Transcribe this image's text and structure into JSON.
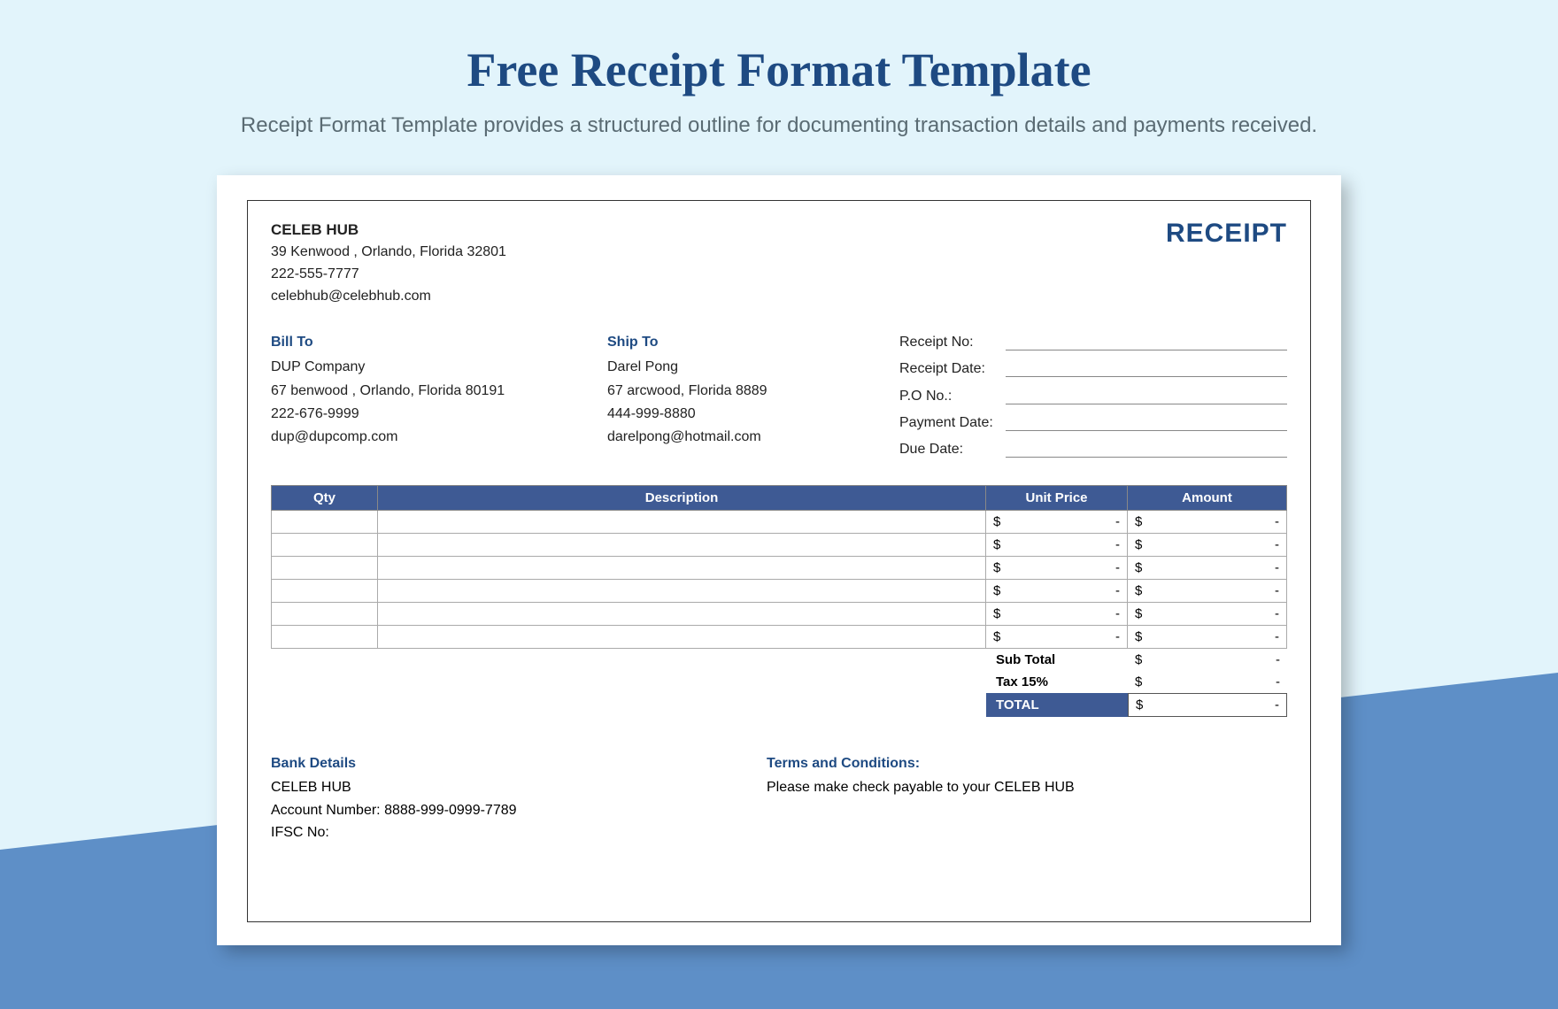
{
  "page": {
    "title": "Free Receipt Format Template",
    "subtitle": "Receipt Format Template provides a structured outline for documenting transaction details and payments received."
  },
  "receipt": {
    "label": "RECEIPT",
    "company": {
      "name": "CELEB HUB",
      "address": "39 Kenwood , Orlando, Florida 32801",
      "phone": "222-555-7777",
      "email": "celebhub@celebhub.com"
    },
    "bill_to": {
      "heading": "Bill To",
      "name": "DUP Company",
      "address": "67 benwood , Orlando, Florida 80191",
      "phone": "222-676-9999",
      "email": "dup@dupcomp.com"
    },
    "ship_to": {
      "heading": "Ship To",
      "name": "Darel Pong",
      "address": "67 arcwood, Florida 8889",
      "phone": "444-999-8880",
      "email": "darelpong@hotmail.com"
    },
    "meta_labels": {
      "receipt_no": "Receipt No:",
      "receipt_date": "Receipt Date:",
      "po_no": "P.O No.:",
      "payment_date": "Payment Date:",
      "due_date": "Due Date:"
    },
    "table": {
      "headers": {
        "qty": "Qty",
        "description": "Description",
        "unit_price": "Unit Price",
        "amount": "Amount"
      },
      "currency": "$",
      "dash": "-",
      "row_count": 6
    },
    "totals": {
      "subtotal_label": "Sub Total",
      "tax_label": "Tax 15%",
      "total_label": "TOTAL",
      "currency": "$",
      "dash": "-"
    },
    "bank": {
      "heading": "Bank Details",
      "name": "CELEB HUB",
      "account_label": "Account Number:",
      "account": "8888-999-0999-7789",
      "ifsc_label": "IFSC No:"
    },
    "terms": {
      "heading": "Terms and Conditions:",
      "body": "Please make check payable to your CELEB HUB"
    }
  }
}
